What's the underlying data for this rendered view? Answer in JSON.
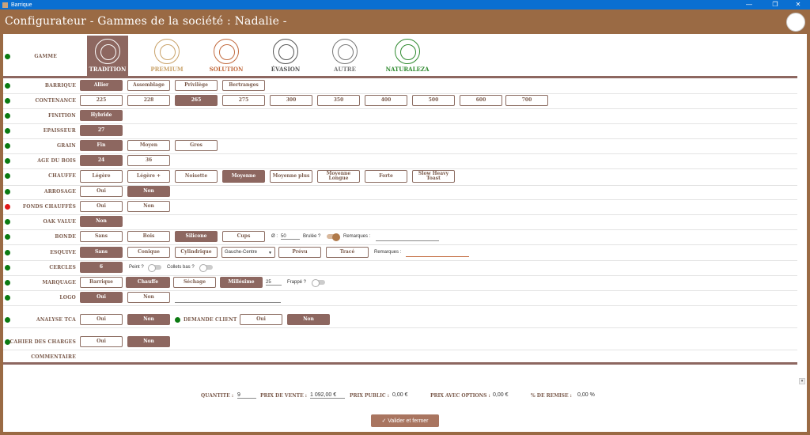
{
  "window": {
    "title": "Barrique",
    "icon": "app-icon"
  },
  "header": {
    "title": "Configurateur  - Gammes de la société :  Nadalie  -"
  },
  "gamme": {
    "label": "GAMME",
    "items": [
      {
        "name": "TRADITION",
        "color": "#ffffff",
        "selected": true
      },
      {
        "name": "PREMIUM",
        "color": "#c9a269",
        "selected": false
      },
      {
        "name": "SOLUTION",
        "color": "#c26b3f",
        "selected": false
      },
      {
        "name": "ÉVASION",
        "color": "#555555",
        "selected": false
      },
      {
        "name": "AUTRE",
        "color": "#777777",
        "selected": false
      },
      {
        "name": "NATURALEZA",
        "color": "#2f8a2f",
        "selected": false
      }
    ]
  },
  "rows": {
    "barrique": {
      "label": "BARRIQUE",
      "options": [
        "Allier",
        "Assemblage",
        "Privilège",
        "Bertranges"
      ]
    },
    "contenance": {
      "label": "CONTENANCE",
      "options": [
        "225",
        "228",
        "265",
        "275",
        "300",
        "350",
        "400",
        "500",
        "600",
        "700"
      ]
    },
    "finition": {
      "label": "FINITION",
      "options": [
        "Hybride"
      ]
    },
    "epaisseur": {
      "label": "EPAISSEUR",
      "options": [
        "27"
      ]
    },
    "grain": {
      "label": "GRAIN",
      "options": [
        "Fin",
        "Moyen",
        "Gros"
      ]
    },
    "age": {
      "label": "AGE DU BOIS",
      "options": [
        "24",
        "36"
      ]
    },
    "chauffe": {
      "label": "CHAUFFE",
      "options": [
        "Légère",
        "Légère +",
        "Noisette",
        "Moyenne",
        "Moyenne plus",
        "Moyenne Longue",
        "Forte",
        "Slow Heavy Toast"
      ]
    },
    "arrosage": {
      "label": "ARROSAGE",
      "options": [
        "Oui",
        "Non"
      ]
    },
    "fonds": {
      "label": "FONDS CHAUFFÉS",
      "options": [
        "Oui",
        "Non"
      ]
    },
    "oak": {
      "label": "OAK VALUE",
      "options": [
        "Non"
      ]
    },
    "bonde": {
      "label": "BONDE",
      "options": [
        "Sans",
        "Bois",
        "Silicone",
        "Cups"
      ],
      "diam_label": "Ø :",
      "diam_value": "50",
      "brulee_label": "Brulée ?",
      "remarques_label": "Remarques :"
    },
    "esquive": {
      "label": "ESQUIVE",
      "options": [
        "Sans",
        "Conique",
        "Cylindrique"
      ],
      "select_value": "Gauche-Centre",
      "prevu": "Prévu",
      "trace": "Tracé",
      "remarques_label": "Remarques :"
    },
    "cercles": {
      "label": "CERCLES",
      "options": [
        "6"
      ],
      "peint_label": "Peint ?",
      "collets_label": "Collets bas ?"
    },
    "marquage": {
      "label": "MARQUAGE",
      "options": [
        "Barrique",
        "Chauffe",
        "Séchage",
        "Millésime"
      ],
      "millesime_value": "25",
      "frappe_label": "Frappé ?"
    },
    "logo": {
      "label": "LOGO",
      "options": [
        "Oui",
        "Non"
      ]
    },
    "analyse": {
      "label": "ANALYSE TCA",
      "options": [
        "Oui",
        "Non"
      ],
      "demande_label": "DEMANDE CLIENT",
      "demande_options": [
        "Oui",
        "Non"
      ]
    },
    "cahier": {
      "label": "CAHIER DES CHARGES",
      "options": [
        "Oui",
        "Non"
      ]
    },
    "commentaire": {
      "label": "COMMENTAIRE"
    }
  },
  "footer": {
    "quantite_label": "QUANTITE :",
    "quantite_value": "9",
    "prix_vente_label": "PRIX DE VENTE :",
    "prix_vente_value": "1 092,00 €",
    "prix_public_label": "PRIX PUBLIC :",
    "prix_public_value": "0,00 €",
    "prix_options_label": "PRIX AVEC OPTIONS :",
    "prix_options_value": "0,00 €",
    "remise_label": "% DE REMISE :",
    "remise_value": "0,00 %",
    "valider_label": "✓ Valider et fermer"
  },
  "colors": {
    "accent": "#8d6760",
    "frame": "#9a6a44",
    "ok": "#0c7a12",
    "error": "#e01818"
  }
}
